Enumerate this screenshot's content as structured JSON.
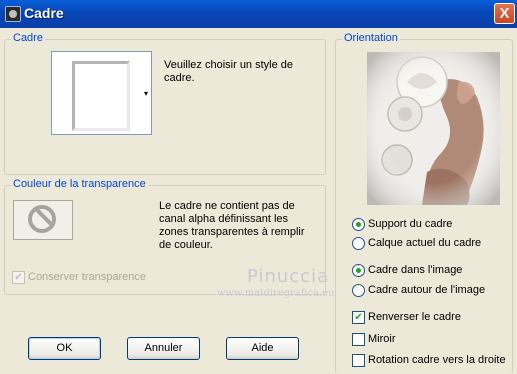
{
  "window": {
    "title": "Cadre",
    "close_glyph": "X"
  },
  "cadre": {
    "group_label": "Cadre",
    "description": "Veuillez choisir un style de cadre.",
    "dropdown_glyph": "▾"
  },
  "transparency": {
    "group_label": "Couleur de la transparence",
    "description": "Le cadre ne contient pas de canal alpha définissant les zones transparentes à remplir de couleur.",
    "keep_transparency_label": "Conserver transparence",
    "keep_transparency_checked": true
  },
  "orientation": {
    "group_label": "Orientation",
    "radio_support": "Support du cadre",
    "radio_layer": "Calque actuel du cadre",
    "radio_inside": "Cadre dans l'image",
    "radio_outside": "Cadre autour de l'image",
    "flip_label": "Renverser le cadre",
    "mirror_label": "Miroir",
    "rotate_label": "Rotation cadre vers la droite"
  },
  "buttons": {
    "ok": "OK",
    "cancel": "Annuler",
    "help": "Aide"
  },
  "watermark": {
    "name": "Pinuccia",
    "url": "www.maidiregrafica.eu"
  },
  "icons": {
    "app": "frame-app-icon",
    "close": "close-icon",
    "no_color": "no-symbol-icon",
    "check": "✔"
  },
  "colors": {
    "titlebar": "#0846b8",
    "group_label": "#0046d5",
    "dialog_bg": "#ece9d8",
    "check": "#21a121"
  }
}
